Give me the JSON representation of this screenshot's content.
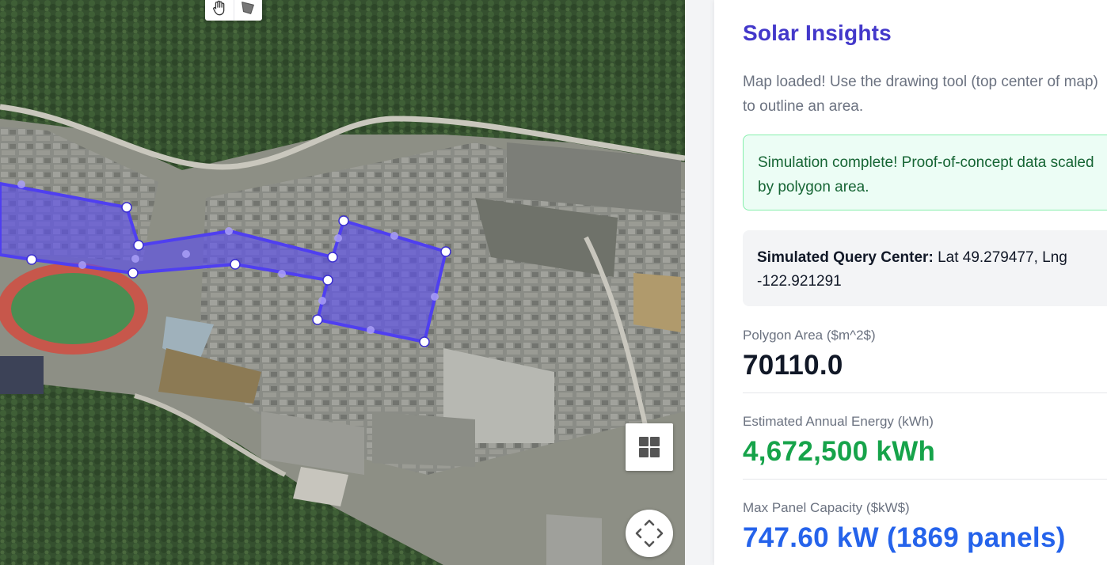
{
  "panel": {
    "title": "Solar Insights",
    "status_message": "Map loaded! Use the drawing tool (top center of map) to outline an area.",
    "success_message": "Simulation complete! Proof-of-concept data scaled by polygon area.",
    "query_center_label": "Simulated Query Center:",
    "query_center_value": "Lat 49.279477, Lng -122.921291",
    "metrics": [
      {
        "label": "Polygon Area ($m^2$)",
        "value": "70110.0",
        "color": "#111827"
      },
      {
        "label": "Estimated Annual Energy (kWh)",
        "value": "4,672,500 kWh",
        "color": "#16a34a"
      },
      {
        "label": "Max Panel Capacity ($kW$)",
        "value": "747.60 kW (1869 panels)",
        "color": "#2563eb"
      }
    ]
  },
  "map": {
    "toolbar": [
      {
        "icon": "hand-icon",
        "tool": "pan"
      },
      {
        "icon": "polygon-icon",
        "tool": "draw-polygon"
      }
    ],
    "map_type_icon": "grid-icon",
    "camera_control_icon": "arrows-move-icon",
    "polygon_fill": "#5b4cf0",
    "polygon_stroke": "#4f3ff0"
  }
}
